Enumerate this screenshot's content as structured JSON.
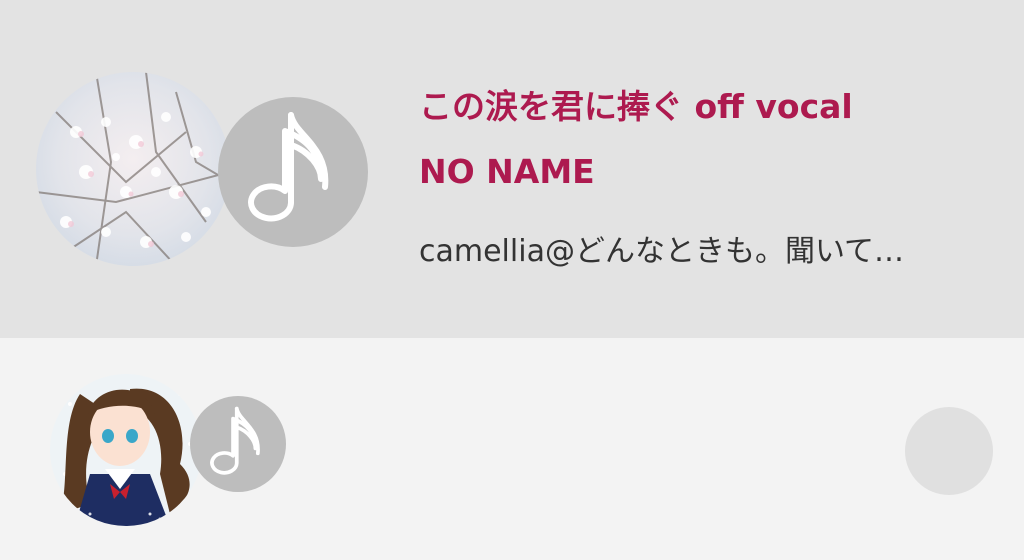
{
  "tracks": [
    {
      "title": "この涙を君に捧ぐ off vocal",
      "artist": "NO NAME",
      "subtitle": "camellia@どんなときも。聞いて…",
      "cover_icon": "blossom-cover-art",
      "badge_icon": "music-note-icon",
      "selected": true
    },
    {
      "title": "",
      "artist": "",
      "subtitle": "",
      "cover_icon": "anime-girl-cover-art",
      "badge_icon": "music-note-icon",
      "selected": false
    }
  ],
  "colors": {
    "selected_row_bg": "#e3e3e3",
    "row_bg": "#f3f3f3",
    "accent_text": "#ad1a4f",
    "subtitle_text": "#333333",
    "note_badge_bg": "#bdbdbd"
  }
}
